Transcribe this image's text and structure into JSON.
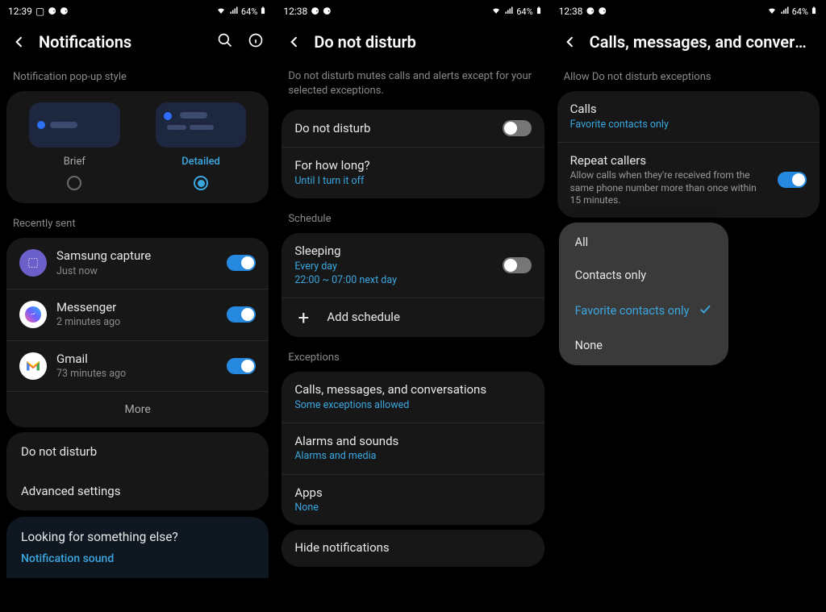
{
  "battery": "64%",
  "pane1": {
    "time": "12:39",
    "title": "Notifications",
    "popstyle_label": "Notification pop-up style",
    "brief": "Brief",
    "detailed": "Detailed",
    "recently_sent": "Recently sent",
    "apps": [
      {
        "name": "Samsung capture",
        "time": "Just now"
      },
      {
        "name": "Messenger",
        "time": "2 minutes ago"
      },
      {
        "name": "Gmail",
        "time": "73 minutes ago"
      }
    ],
    "more": "More",
    "dnd": "Do not disturb",
    "advanced": "Advanced settings",
    "suggest_title": "Looking for something else?",
    "suggest_link": "Notification sound"
  },
  "pane2": {
    "time": "12:38",
    "title": "Do not disturb",
    "sub": "Do not disturb mutes calls and alerts except for your selected exceptions.",
    "dnd_title": "Do not disturb",
    "forhowlong": "For how long?",
    "forhowlong_sub": "Until I turn it off",
    "schedule_label": "Schedule",
    "sleeping": "Sleeping",
    "sleeping_sub1": "Every day",
    "sleeping_sub2": "22:00 ~ 07:00 next day",
    "add_schedule": "Add schedule",
    "exceptions_label": "Exceptions",
    "calls_msgs": "Calls, messages, and conversations",
    "calls_msgs_sub": "Some exceptions allowed",
    "alarms": "Alarms and sounds",
    "alarms_sub": "Alarms and media",
    "apps": "Apps",
    "apps_sub": "None",
    "hide": "Hide notifications"
  },
  "pane3": {
    "time": "12:38",
    "title": "Calls, messages, and conversa…",
    "allow_label": "Allow Do not disturb exceptions",
    "calls": "Calls",
    "calls_sub": "Favorite contacts only",
    "repeat": "Repeat callers",
    "repeat_sub": "Allow calls when they're received from the same phone number more than once within 15 minutes.",
    "popup": {
      "all": "All",
      "contacts": "Contacts only",
      "fav": "Favorite contacts only",
      "none": "None"
    }
  }
}
